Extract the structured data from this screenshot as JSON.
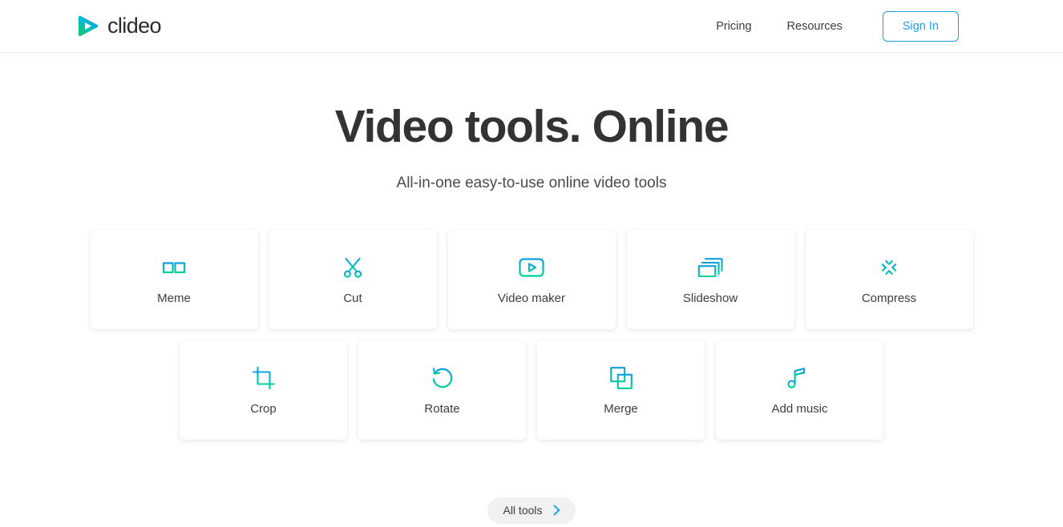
{
  "header": {
    "logo_text": "clideo",
    "logo_icon": "play-triangle-logo",
    "nav": [
      {
        "label": "Pricing",
        "name": "pricing"
      },
      {
        "label": "Resources",
        "name": "resources"
      }
    ],
    "signin_label": "Sign In",
    "accent_blue": "#1f9fe3"
  },
  "hero": {
    "title": "Video tools. Online",
    "subtitle": "All-in-one easy-to-use online video tools"
  },
  "tools": {
    "row1": [
      {
        "label": "Meme",
        "icon": "glasses-icon"
      },
      {
        "label": "Cut",
        "icon": "scissors-icon"
      },
      {
        "label": "Video maker",
        "icon": "video-play-frame-icon"
      },
      {
        "label": "Slideshow",
        "icon": "stacked-slides-icon"
      },
      {
        "label": "Compress",
        "icon": "compress-arrows-icon"
      }
    ],
    "row2": [
      {
        "label": "Crop",
        "icon": "crop-marks-icon"
      },
      {
        "label": "Rotate",
        "icon": "rotate-ccw-icon"
      },
      {
        "label": "Merge",
        "icon": "overlapping-squares-icon"
      },
      {
        "label": "Add music",
        "icon": "music-note-plus-icon"
      }
    ]
  },
  "footer": {
    "all_tools_label": "All tools",
    "chevron_icon": "chevron-right-icon"
  },
  "colors": {
    "gradient_top": "#0f9fe0",
    "gradient_bottom": "#00d09c",
    "text_dark": "#333333",
    "pill_bg": "#f1f1f1"
  }
}
